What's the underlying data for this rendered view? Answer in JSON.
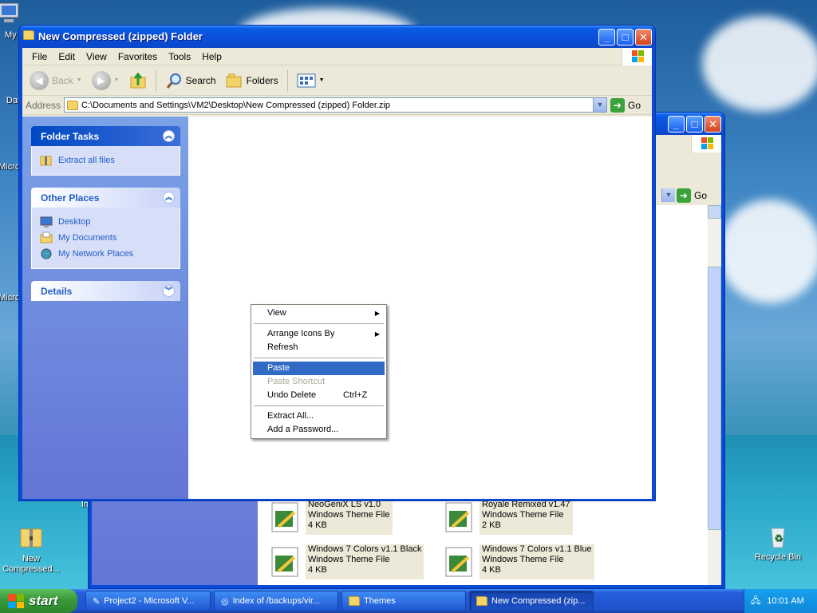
{
  "desktop": {
    "icons": [
      {
        "label": "My",
        "id": "my-computer"
      },
      {
        "label": "Dat",
        "id": "data"
      },
      {
        "label": "Micro",
        "id": "microsoft-1"
      },
      {
        "label": "Micro",
        "id": "microsoft-2"
      },
      {
        "label": "In",
        "id": "in"
      },
      {
        "label": "New Compressed...",
        "id": "new-compressed"
      },
      {
        "label": "Recycle Bin",
        "id": "recycle-bin"
      }
    ]
  },
  "back_window": {
    "go_label": "Go",
    "files": [
      {
        "name": "NeoGeniX LS v1.0",
        "type": "Windows Theme File",
        "size": "4 KB"
      },
      {
        "name": "Royale Remixed v1.47",
        "type": "Windows Theme File",
        "size": "2 KB"
      },
      {
        "name": "Windows 7 Colors v1.1 Black",
        "type": "Windows Theme File",
        "size": "4 KB"
      },
      {
        "name": "Windows 7 Colors v1.1 Blue",
        "type": "Windows Theme File",
        "size": "4 KB"
      }
    ]
  },
  "window": {
    "title": "New Compressed (zipped) Folder",
    "menu": [
      "File",
      "Edit",
      "View",
      "Favorites",
      "Tools",
      "Help"
    ],
    "toolbar": {
      "back": "Back",
      "search": "Search",
      "folders": "Folders"
    },
    "address": {
      "label": "Address",
      "value": "C:\\Documents and Settings\\VM2\\Desktop\\New Compressed (zipped) Folder.zip",
      "go": "Go"
    },
    "taskpane": {
      "folder_tasks": {
        "title": "Folder Tasks",
        "items": [
          "Extract all files"
        ]
      },
      "other_places": {
        "title": "Other Places",
        "items": [
          "Desktop",
          "My Documents",
          "My Network Places"
        ]
      },
      "details": {
        "title": "Details"
      }
    }
  },
  "context_menu": {
    "items": [
      {
        "label": "View",
        "submenu": true
      },
      {
        "label": "Arrange Icons By",
        "submenu": true
      },
      {
        "label": "Refresh"
      },
      {
        "label": "Paste",
        "selected": true
      },
      {
        "label": "Paste Shortcut",
        "disabled": true
      },
      {
        "label": "Undo Delete",
        "shortcut": "Ctrl+Z"
      },
      {
        "label": "Extract All..."
      },
      {
        "label": "Add a Password..."
      }
    ]
  },
  "taskbar": {
    "start": "start",
    "tasks": [
      {
        "label": "Project2 - Microsoft V...",
        "active": false
      },
      {
        "label": "Index of /backups/vir...",
        "active": false
      },
      {
        "label": "Themes",
        "active": false
      },
      {
        "label": "New Compressed (zip...",
        "active": true
      }
    ],
    "clock": "10:01 AM"
  },
  "colors": {
    "xp_blue": "#0a4bd6",
    "task_link": "#215dc6",
    "menu_highlight": "#316ac5",
    "start_green": "#3a9c3a"
  }
}
